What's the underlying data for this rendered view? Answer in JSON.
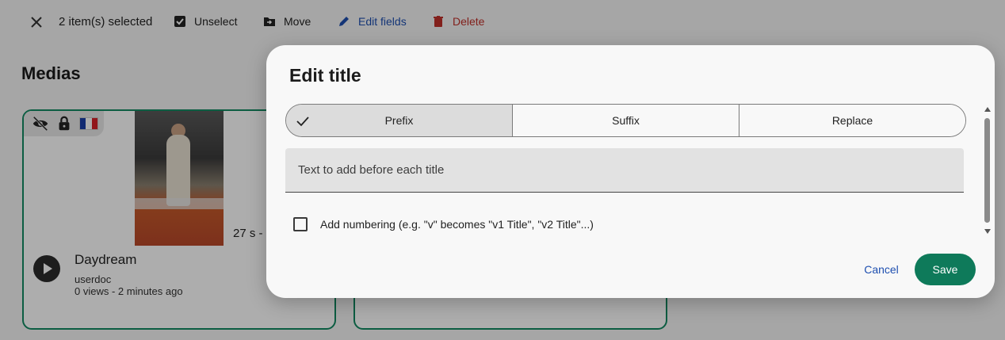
{
  "toolbar": {
    "selected_count": "2 item(s) selected",
    "unselect_label": "Unselect",
    "move_label": "Move",
    "edit_fields_label": "Edit fields",
    "delete_label": "Delete"
  },
  "section_title": "Medias",
  "media_card": {
    "title": "Daydream",
    "author": "userdoc",
    "meta": "0 views  - 2 minutes ago",
    "duration": "27 s  -"
  },
  "modal": {
    "title": "Edit title",
    "modes": [
      {
        "label": "Prefix",
        "selected": true
      },
      {
        "label": "Suffix",
        "selected": false
      },
      {
        "label": "Replace",
        "selected": false
      }
    ],
    "text_placeholder": "Text to add before each title",
    "numbering_label": "Add numbering (e.g. \"v\" becomes \"v1 Title\", \"v2 Title\"...)",
    "cancel_label": "Cancel",
    "save_label": "Save"
  },
  "colors": {
    "accent": "#0e7a5a",
    "link": "#1e4fb0",
    "danger": "#c0302a"
  },
  "icons": {
    "close": "close-icon",
    "unselect": "checkbox-checked-icon",
    "move": "folder-move-icon",
    "edit": "pencil-icon",
    "delete": "trash-icon",
    "hidden": "eye-off-icon",
    "locked": "lock-icon",
    "language": "flag-fr-icon",
    "check": "check-icon"
  }
}
